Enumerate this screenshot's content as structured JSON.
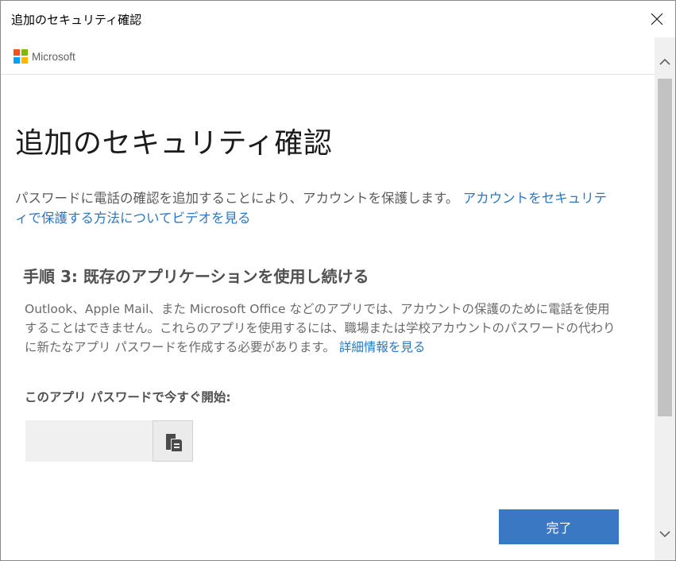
{
  "window": {
    "title": "追加のセキュリティ確認"
  },
  "header": {
    "brand": "Microsoft"
  },
  "main": {
    "heading": "追加のセキュリティ確認",
    "intro_text": "パスワードに電話の確認を追加することにより、アカウントを保護します。",
    "intro_link": "アカウントをセキュリティで保護する方法についてビデオを見る",
    "step_heading": "手順 3: 既存のアプリケーションを使用し続ける",
    "step_desc": "Outlook、Apple Mail、また Microsoft Office などのアプリでは、アカウントの保護のために電話を使用することはできません。これらのアプリを使用するには、職場または学校アカウントのパスワードの代わりに新たなアプリ パスワードを作成する必要があります。",
    "step_link": "詳細情報を見る",
    "start_label": "このアプリ パスワードで今すぐ開始:",
    "app_password": "",
    "done_label": "完了"
  },
  "colors": {
    "accent": "#3b78c4",
    "link": "#2a76c6"
  },
  "icons": {
    "close": "close-icon",
    "copy": "copy-icon",
    "scroll_up": "chevron-up-icon",
    "scroll_down": "chevron-down-icon"
  }
}
